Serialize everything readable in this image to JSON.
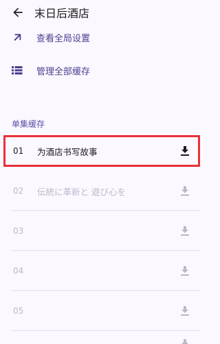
{
  "header": {
    "back_icon": "arrow-left-icon",
    "title": "末日后酒店"
  },
  "menu": [
    {
      "icon": "arrow-up-right-icon",
      "label": "查看全局设置"
    },
    {
      "icon": "list-icon",
      "label": "管理全部缓存"
    }
  ],
  "section": {
    "title": "单集缓存"
  },
  "episodes": [
    {
      "number": "01",
      "title": "为酒店书写故事",
      "state": "active",
      "icon": "download-icon"
    },
    {
      "number": "02",
      "title": "伝統に革新と 遊び心を",
      "state": "dim",
      "icon": "download-icon"
    },
    {
      "number": "03",
      "title": "",
      "state": "dim",
      "icon": "download-icon"
    },
    {
      "number": "04",
      "title": "",
      "state": "dim",
      "icon": "download-icon"
    },
    {
      "number": "05",
      "title": "",
      "state": "dim",
      "icon": "download-icon"
    }
  ],
  "colors": {
    "background": "#fcf8ff",
    "accent": "#4a3f8e",
    "highlight_border": "#e8303a",
    "dim_text": "#bdb8c9"
  }
}
